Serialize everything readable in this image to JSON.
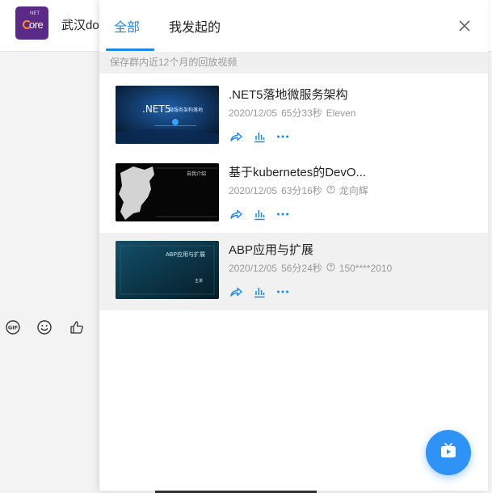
{
  "background": {
    "chat_title": "武汉dot",
    "avatar_text_small": "NET",
    "avatar_text_main": "ore",
    "toolbar_icons": [
      "gif-icon",
      "emoji-icon",
      "thumbs-up-icon"
    ]
  },
  "panel": {
    "tabs": [
      {
        "label": "全部",
        "active": true
      },
      {
        "label": "我发起的",
        "active": false
      }
    ],
    "notice": "保存群内近12个月的回放视频",
    "videos": [
      {
        "title": ".NET5落地微服务架构",
        "date": "2020/12/05",
        "duration": "65分33秒",
        "author": "Eleven",
        "author_has_icon": false,
        "thumb_text": ".NET5",
        "thumb_sub": "微服务架构落地"
      },
      {
        "title": "基于kubernetes的DevO...",
        "date": "2020/12/05",
        "duration": "63分16秒",
        "author": "龙向辉",
        "author_has_icon": true,
        "thumb_text": "",
        "thumb_sub": "自我介绍"
      },
      {
        "title": "ABP应用与扩展",
        "date": "2020/12/05",
        "duration": "56分24秒",
        "author": "150****2010",
        "author_has_icon": true,
        "thumb_text": "ABP应用与扩展",
        "thumb_sub": "主讲"
      }
    ]
  },
  "colors": {
    "accent": "#1e88e5",
    "fab": "#2f93f6",
    "notice_bg": "#f0f0f0",
    "hover_bg": "#f1f1f1"
  }
}
